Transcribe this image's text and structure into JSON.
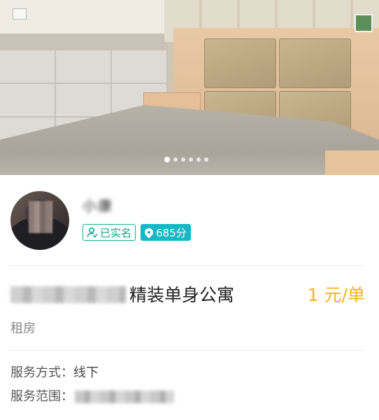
{
  "gallery": {
    "photo_icon": "bedroom-photo",
    "slide_count": 6,
    "active_slide": 1
  },
  "profile": {
    "username": "小康",
    "verified_label": "已实名",
    "verified_icon": "person-check-icon",
    "score_label": "685分",
    "score_icon": "drop-icon"
  },
  "listing": {
    "title": "精装单身公寓",
    "price": "1 元/单",
    "category": "租房",
    "service_mode_label": "服务方式：",
    "service_mode_value": "线下",
    "service_area_label": "服务范围："
  },
  "colors": {
    "price": "#f7b21a",
    "verified": "#15b18d",
    "score_bg": "#14b8c6"
  }
}
